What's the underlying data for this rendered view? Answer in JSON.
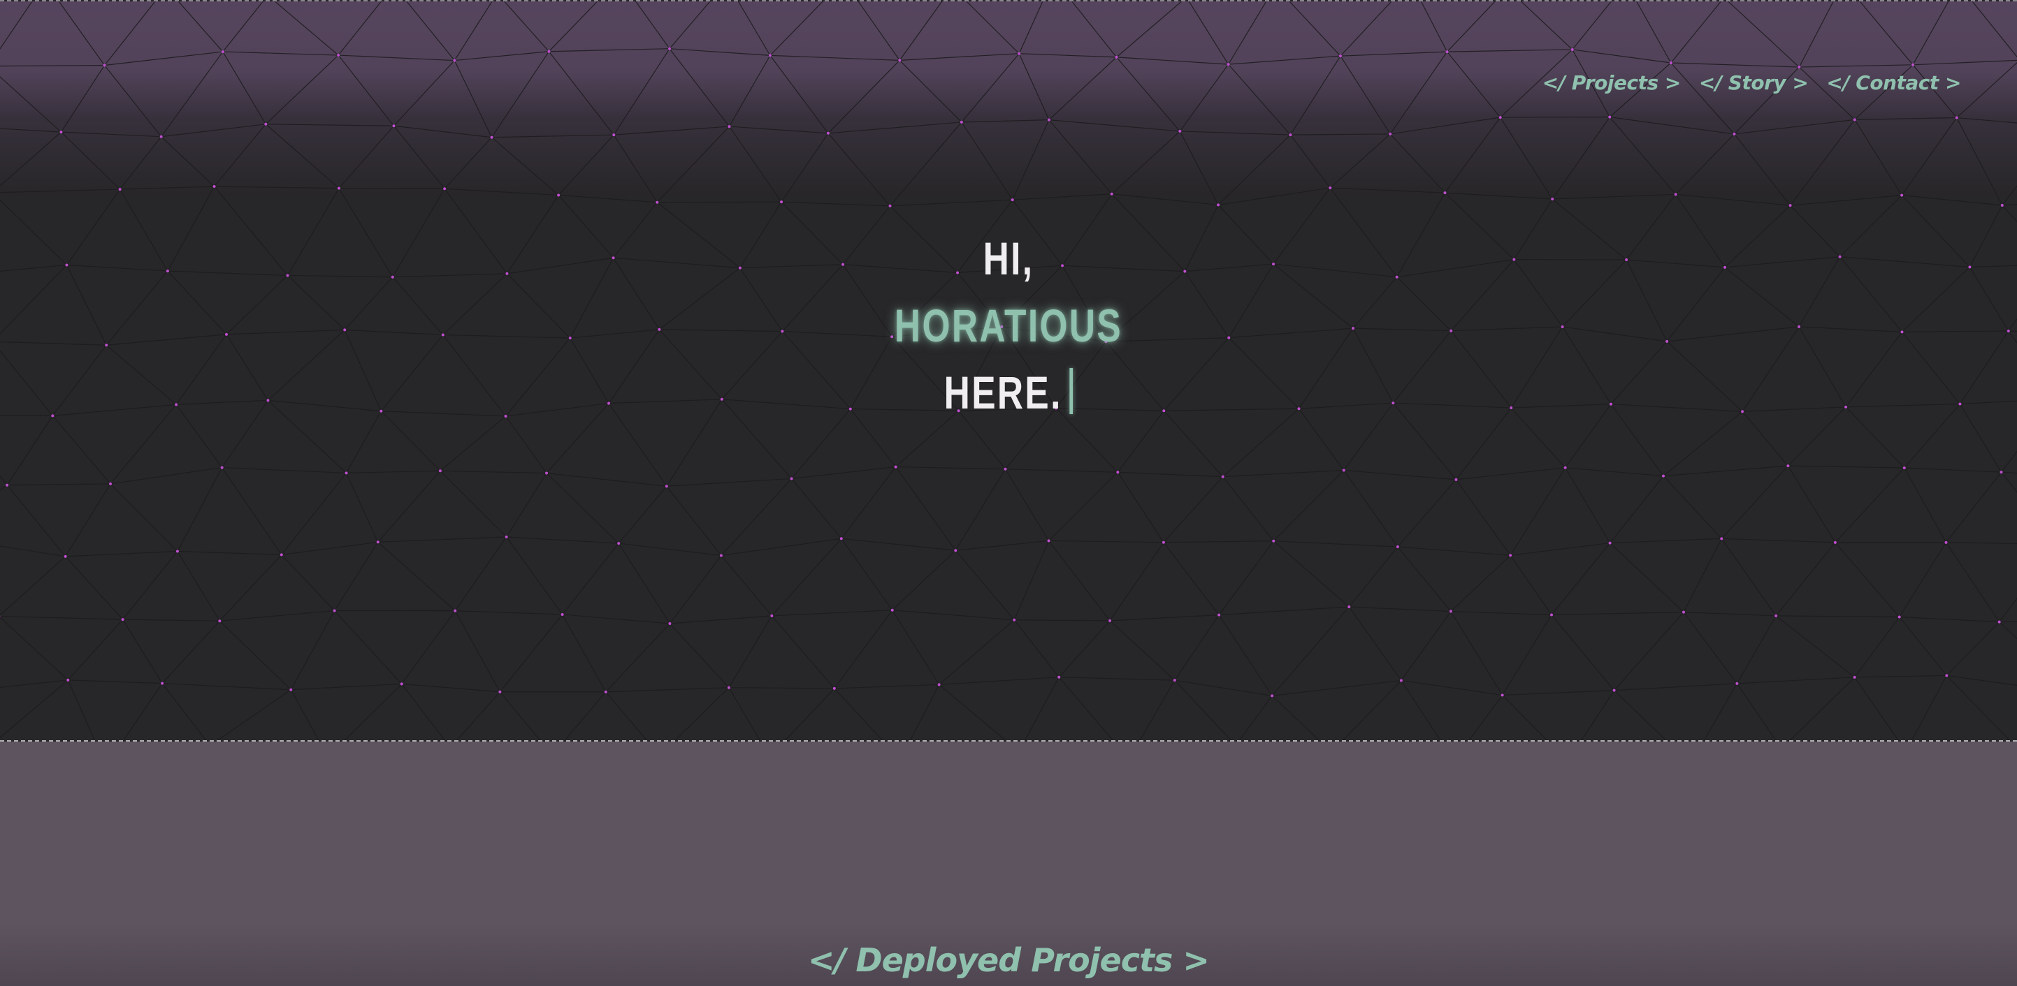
{
  "nav": {
    "items": [
      {
        "label": "</ Projects >"
      },
      {
        "label": "</ Story >"
      },
      {
        "label": "</ Contact >"
      }
    ]
  },
  "hero": {
    "line1": "HI,",
    "line2": "HORATIOUS",
    "line3": "HERE."
  },
  "projects": {
    "title": "</ Deployed Projects >"
  },
  "colors": {
    "accent": "#8fc1ae",
    "hero_bg": "#272628",
    "glow": "#584660",
    "dots": "#c04fd0",
    "section_bg": "#5d545f",
    "text": "#f0eef0"
  }
}
